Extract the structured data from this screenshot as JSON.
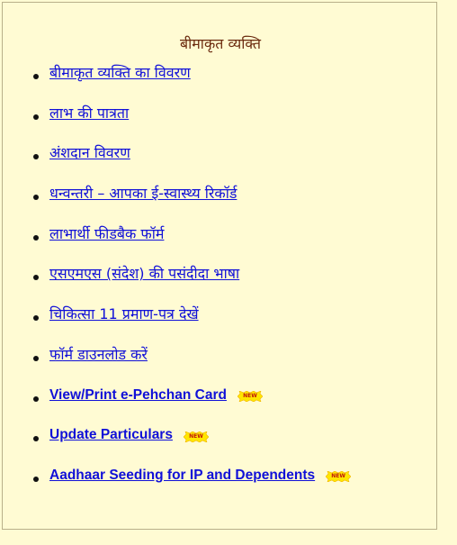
{
  "panel": {
    "title": "बीमाकृत व्यक्ति"
  },
  "links": [
    {
      "label": "बीमाकृत व्यक्ति का विवरण",
      "new": false
    },
    {
      "label": "लाभ की पात्रता",
      "new": false
    },
    {
      "label": "अंशदान विवरण",
      "new": false
    },
    {
      "label": "धन्वन्तरी – आपका ई-स्वास्थ्य रिकॉर्ड",
      "new": false
    },
    {
      "label": "लाभार्थी फीडबैक फॉर्म",
      "new": false
    },
    {
      "label": "एसएमएस (संदेश) की पसंदीदा भाषा",
      "new": false
    },
    {
      "label": "चिकित्सा 11 प्रमाण-पत्र देखें",
      "new": false
    },
    {
      "label": "फॉर्म डाउनलोड करें",
      "new": false
    },
    {
      "label": "View/Print e-Pehchan Card",
      "new": true
    },
    {
      "label": "Update Particulars",
      "new": true
    },
    {
      "label": "Aadhaar Seeding for IP and Dependents",
      "new": true
    }
  ],
  "badge": {
    "text": "NEW",
    "icon": "new-starburst-icon",
    "fill_color": "#ffe600",
    "text_color": "#c0180c"
  },
  "colors": {
    "background": "#fffbd3",
    "title": "#6b2a0e",
    "link": "#1010d8"
  }
}
